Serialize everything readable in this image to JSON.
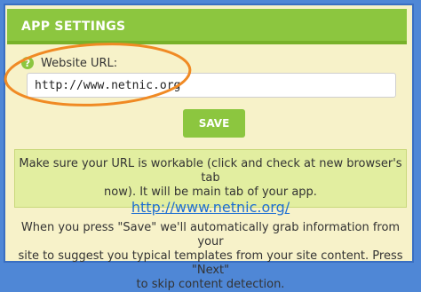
{
  "header": {
    "title": "APP SETTINGS"
  },
  "form": {
    "help_icon": "help-question-icon",
    "url_label": "Website URL:",
    "url_value": "http://www.netnic.org",
    "save_label": "SAVE"
  },
  "info": {
    "line1": "Make sure your URL is workable (click and check at new browser's tab",
    "line2": "now). It will be main tab of your app.",
    "link": "http://www.netnic.org/"
  },
  "note": {
    "line1": "When you press \"Save\" we'll automatically grab information from your",
    "line2": "site to suggest you typical templates from your site content. Press \"Next\"",
    "line3": "to skip content detection."
  },
  "colors": {
    "accent_green": "#8cc63f",
    "panel_bg": "#f7f2c9",
    "info_bg": "#e2eea0",
    "annotation": "#f08a24",
    "link": "#1f6fd1"
  }
}
